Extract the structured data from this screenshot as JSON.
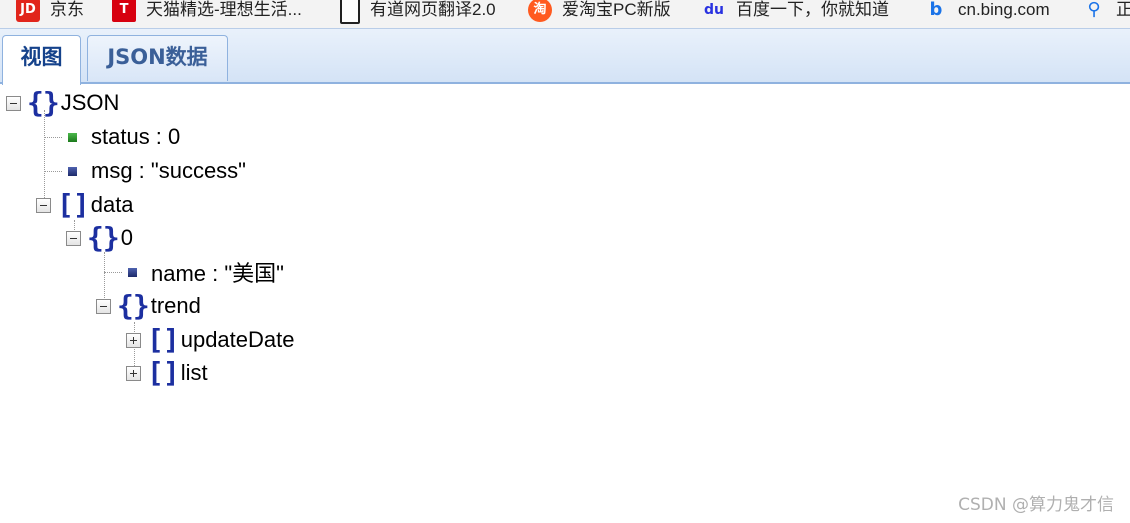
{
  "bookmarks": [
    {
      "label": "京东",
      "icon": "jd-logo-icon"
    },
    {
      "label": "天猫精选-理想生活...",
      "icon": "tmall-logo-icon"
    },
    {
      "label": "有道网页翻译2.0",
      "icon": "document-icon"
    },
    {
      "label": "爱淘宝PC新版",
      "icon": "aitaobao-logo-icon"
    },
    {
      "label": "百度一下，你就知道",
      "icon": "baidu-logo-icon"
    },
    {
      "label": "cn.bing.com",
      "icon": "bing-logo-icon"
    },
    {
      "label": "正",
      "icon": "search-icon"
    }
  ],
  "tabs": [
    {
      "label": "视图",
      "active": true
    },
    {
      "label": "JSON数据",
      "active": false
    }
  ],
  "tree": {
    "root": "JSON",
    "status": "status : 0",
    "msg": "msg : \"success\"",
    "data": "data",
    "item0": "0",
    "name": "name : \"美国\"",
    "trend": "trend",
    "updateDate": "updateDate",
    "list": "list"
  },
  "colors": {
    "brace": "#1c2fa0",
    "tab_text": "#15428b",
    "tab_border": "#8fb2df",
    "number_leaf": "#1c7a1c",
    "string_leaf": "#1d2a6a"
  },
  "watermark": "CSDN @算力鬼才信"
}
